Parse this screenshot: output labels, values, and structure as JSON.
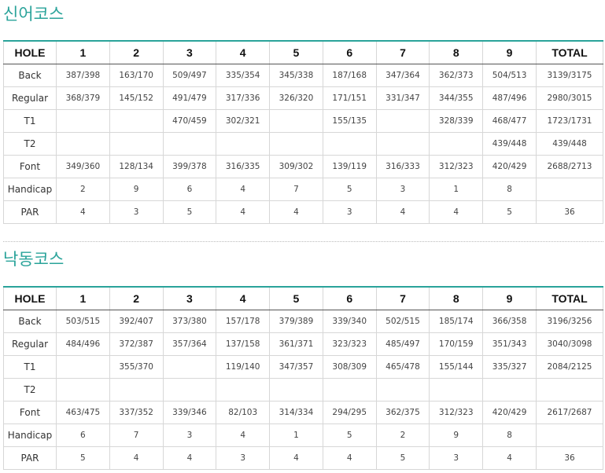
{
  "headers": [
    "HOLE",
    "1",
    "2",
    "3",
    "4",
    "5",
    "6",
    "7",
    "8",
    "9",
    "TOTAL"
  ],
  "courses": [
    {
      "title": "신어코스",
      "rows": [
        [
          "Back",
          "387/398",
          "163/170",
          "509/497",
          "335/354",
          "345/338",
          "187/168",
          "347/364",
          "362/373",
          "504/513",
          "3139/3175"
        ],
        [
          "Regular",
          "368/379",
          "145/152",
          "491/479",
          "317/336",
          "326/320",
          "171/151",
          "331/347",
          "344/355",
          "487/496",
          "2980/3015"
        ],
        [
          "T1",
          "",
          "",
          "470/459",
          "302/321",
          "",
          "155/135",
          "",
          "328/339",
          "468/477",
          "1723/1731"
        ],
        [
          "T2",
          "",
          "",
          "",
          "",
          "",
          "",
          "",
          "",
          "439/448",
          "439/448"
        ],
        [
          "Font",
          "349/360",
          "128/134",
          "399/378",
          "316/335",
          "309/302",
          "139/119",
          "316/333",
          "312/323",
          "420/429",
          "2688/2713"
        ],
        [
          "Handicap",
          "2",
          "9",
          "6",
          "4",
          "7",
          "5",
          "3",
          "1",
          "8",
          ""
        ],
        [
          "PAR",
          "4",
          "3",
          "5",
          "4",
          "4",
          "3",
          "4",
          "4",
          "5",
          "36"
        ]
      ]
    },
    {
      "title": "낙동코스",
      "rows": [
        [
          "Back",
          "503/515",
          "392/407",
          "373/380",
          "157/178",
          "379/389",
          "339/340",
          "502/515",
          "185/174",
          "366/358",
          "3196/3256"
        ],
        [
          "Regular",
          "484/496",
          "372/387",
          "357/364",
          "137/158",
          "361/371",
          "323/323",
          "485/497",
          "170/159",
          "351/343",
          "3040/3098"
        ],
        [
          "T1",
          "",
          "355/370",
          "",
          "119/140",
          "347/357",
          "308/309",
          "465/478",
          "155/144",
          "335/327",
          "2084/2125"
        ],
        [
          "T2",
          "",
          "",
          "",
          "",
          "",
          "",
          "",
          "",
          "",
          ""
        ],
        [
          "Font",
          "463/475",
          "337/352",
          "339/346",
          "82/103",
          "314/334",
          "294/295",
          "362/375",
          "312/323",
          "420/429",
          "2617/2687"
        ],
        [
          "Handicap",
          "6",
          "7",
          "3",
          "4",
          "1",
          "5",
          "2",
          "9",
          "8",
          ""
        ],
        [
          "PAR",
          "5",
          "4",
          "4",
          "3",
          "4",
          "4",
          "5",
          "3",
          "4",
          "36"
        ]
      ]
    }
  ]
}
